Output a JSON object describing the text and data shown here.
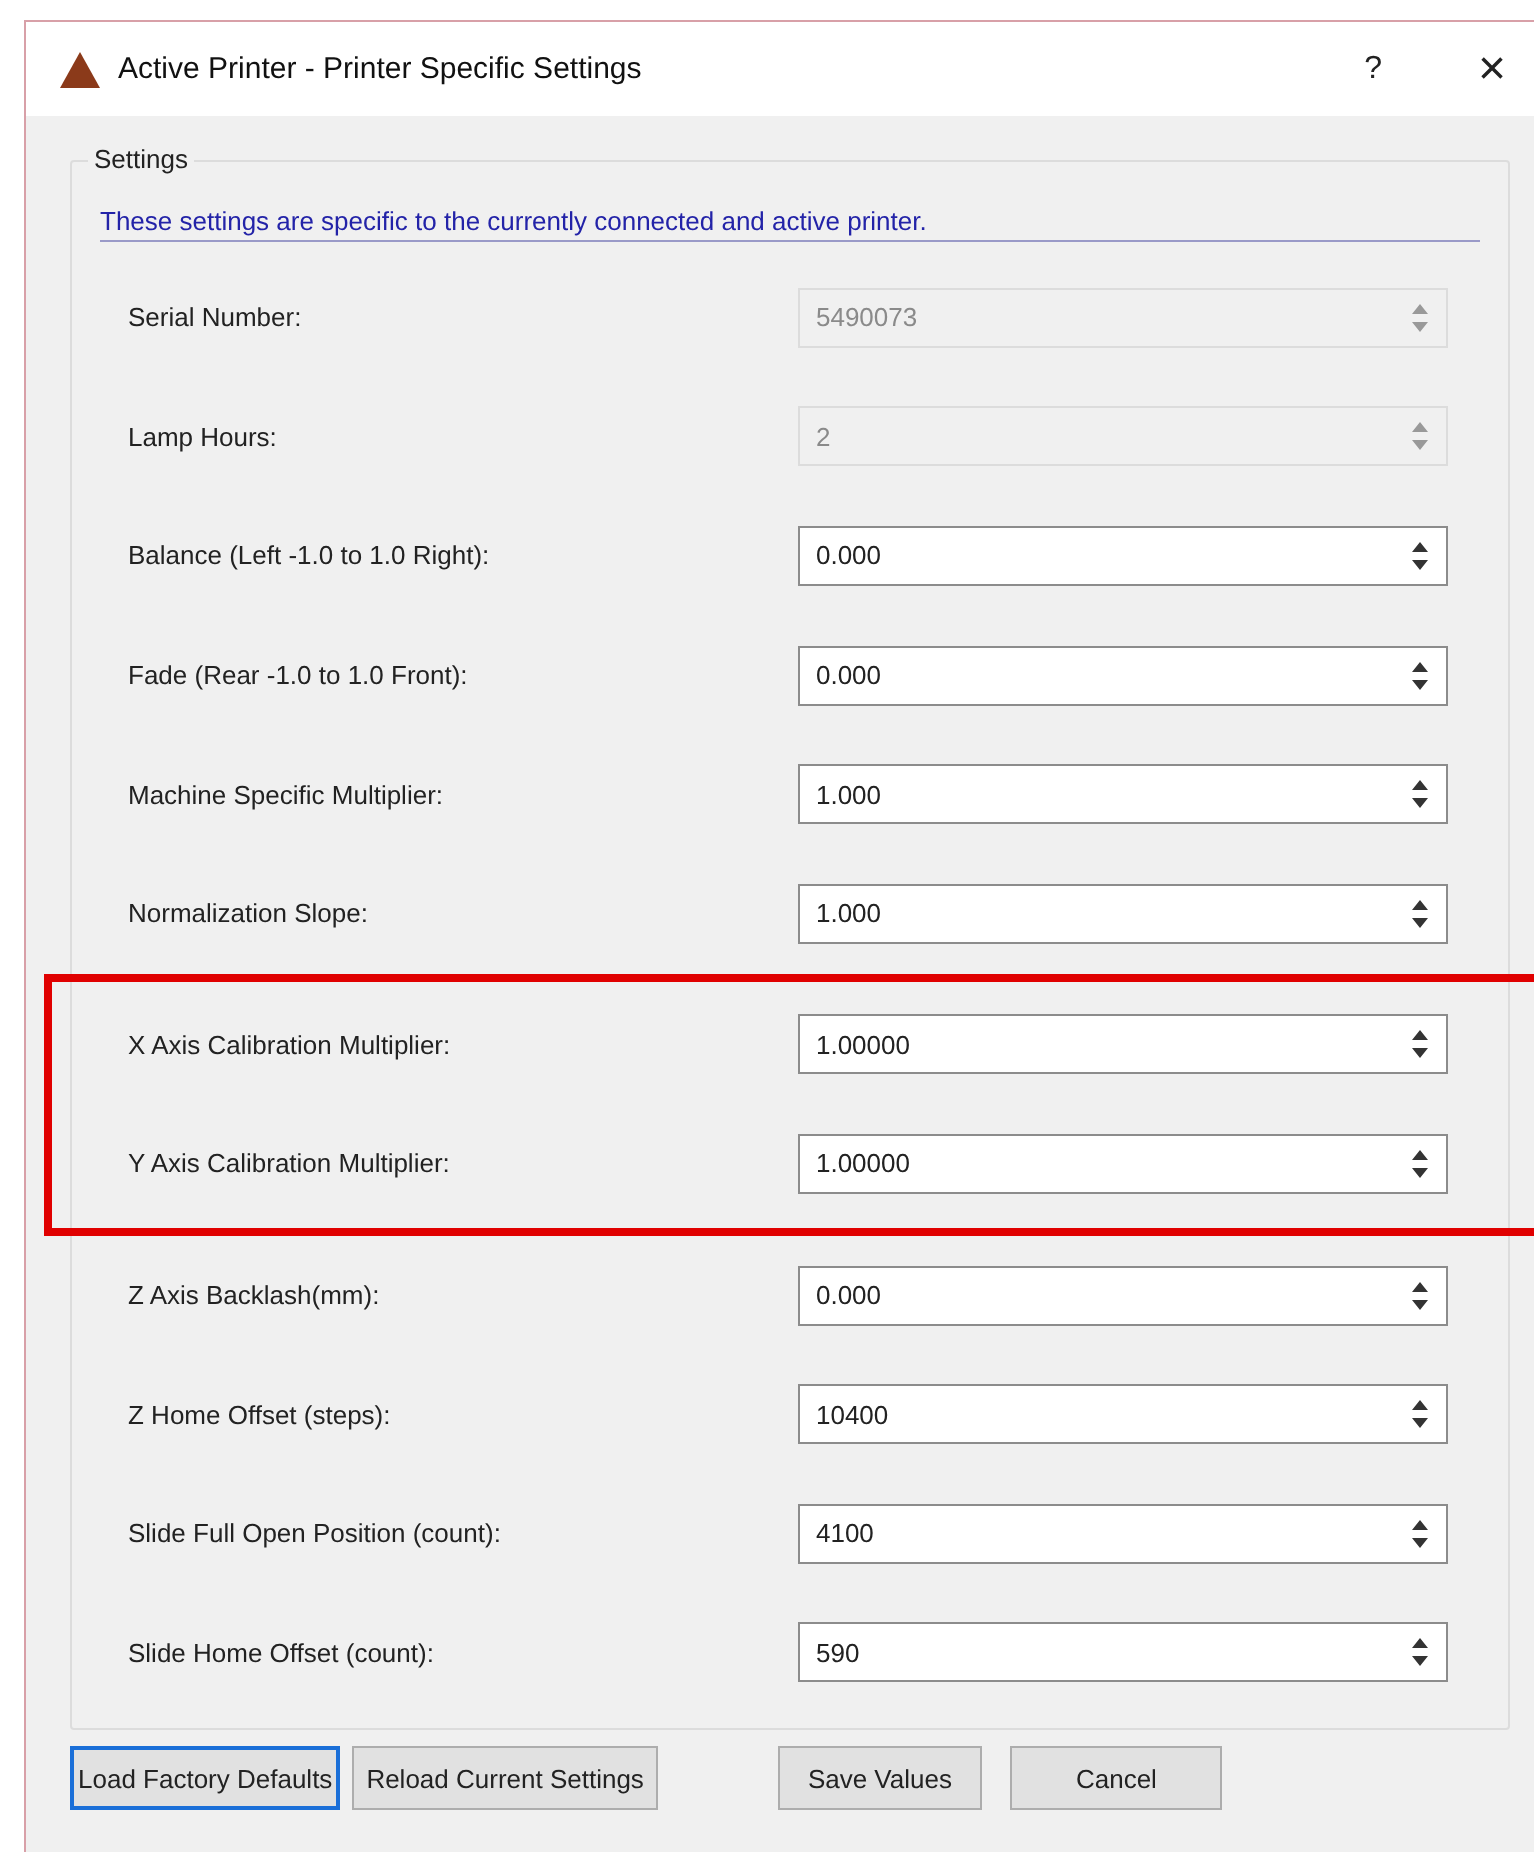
{
  "window": {
    "title": "Active Printer - Printer Specific Settings",
    "help": "?",
    "close": "×"
  },
  "group": {
    "title": "Settings",
    "info": "These settings are specific to the currently connected and active printer."
  },
  "fields": [
    {
      "label": "Serial Number:",
      "value": "5490073",
      "disabled": true,
      "highlighted": false
    },
    {
      "label": "Lamp Hours:",
      "value": "2",
      "disabled": true,
      "highlighted": false
    },
    {
      "label": "Balance (Left -1.0 to 1.0 Right):",
      "value": "0.000",
      "disabled": false,
      "highlighted": false
    },
    {
      "label": "Fade (Rear -1.0 to 1.0 Front):",
      "value": "0.000",
      "disabled": false,
      "highlighted": false
    },
    {
      "label": "Machine Specific Multiplier:",
      "value": "1.000",
      "disabled": false,
      "highlighted": false
    },
    {
      "label": "Normalization Slope:",
      "value": "1.000",
      "disabled": false,
      "highlighted": false
    },
    {
      "label": "X Axis Calibration Multiplier:",
      "value": "1.00000",
      "disabled": false,
      "highlighted": true
    },
    {
      "label": "Y Axis Calibration Multiplier:",
      "value": "1.00000",
      "disabled": false,
      "highlighted": true
    },
    {
      "label": "Z Axis Backlash(mm):",
      "value": "0.000",
      "disabled": false,
      "highlighted": false
    },
    {
      "label": "Z Home Offset (steps):",
      "value": "10400",
      "disabled": false,
      "highlighted": false
    },
    {
      "label": "Slide Full Open Position (count):",
      "value": "4100",
      "disabled": false,
      "highlighted": false
    },
    {
      "label": "Slide Home Offset (count):",
      "value": "590",
      "disabled": false,
      "highlighted": false
    }
  ],
  "buttons": [
    {
      "label": "Load Factory Defaults",
      "focused": true
    },
    {
      "label": "Reload Current Settings",
      "focused": false
    },
    {
      "label": "Save Values",
      "focused": false
    },
    {
      "label": "Cancel",
      "focused": false
    }
  ]
}
